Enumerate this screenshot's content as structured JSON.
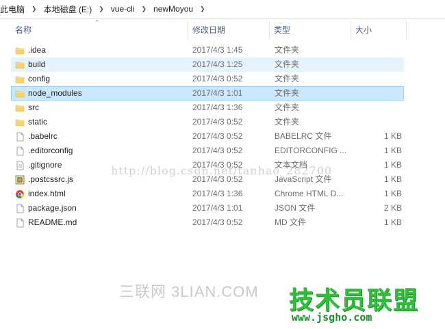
{
  "breadcrumb": [
    "此电脑",
    "本地磁盘 (E:)",
    "vue-cli",
    "newMoyou"
  ],
  "columns": {
    "name": "名称",
    "date": "修改日期",
    "type": "类型",
    "size": "大小"
  },
  "files": [
    {
      "name": ".idea",
      "date": "2017/4/3 1:45",
      "type": "文件夹",
      "size": "",
      "icon": "folder-icon",
      "state": "normal"
    },
    {
      "name": "build",
      "date": "2017/4/3 1:25",
      "type": "文件夹",
      "size": "",
      "icon": "folder-icon",
      "state": "hover"
    },
    {
      "name": "config",
      "date": "2017/4/3 0:52",
      "type": "文件夹",
      "size": "",
      "icon": "folder-icon",
      "state": "normal"
    },
    {
      "name": "node_modules",
      "date": "2017/4/3 1:01",
      "type": "文件夹",
      "size": "",
      "icon": "folder-icon",
      "state": "selected"
    },
    {
      "name": "src",
      "date": "2017/4/3 1:36",
      "type": "文件夹",
      "size": "",
      "icon": "folder-icon",
      "state": "normal"
    },
    {
      "name": "static",
      "date": "2017/4/3 0:52",
      "type": "文件夹",
      "size": "",
      "icon": "folder-icon",
      "state": "normal"
    },
    {
      "name": ".babelrc",
      "date": "2017/4/3 0:52",
      "type": "BABELRC 文件",
      "size": "1 KB",
      "icon": "file-icon",
      "state": "normal"
    },
    {
      "name": ".editorconfig",
      "date": "2017/4/3 0:52",
      "type": "EDITORCONFIG ...",
      "size": "1 KB",
      "icon": "file-icon",
      "state": "normal"
    },
    {
      "name": ".gitignore",
      "date": "2017/4/3 0:52",
      "type": "文本文档",
      "size": "1 KB",
      "icon": "text-file-icon",
      "state": "normal"
    },
    {
      "name": ".postcssrc.js",
      "date": "2017/4/3 0:52",
      "type": "JavaScript 文件",
      "size": "1 KB",
      "icon": "javascript-file-icon",
      "state": "normal"
    },
    {
      "name": "index.html",
      "date": "2017/4/3 1:36",
      "type": "Chrome HTML D...",
      "size": "1 KB",
      "icon": "chrome-icon",
      "state": "normal"
    },
    {
      "name": "package.json",
      "date": "2017/4/3 1:01",
      "type": "JSON 文件",
      "size": "2 KB",
      "icon": "file-icon",
      "state": "normal"
    },
    {
      "name": "README.md",
      "date": "2017/4/3 0:52",
      "type": "MD 文件",
      "size": "1 KB",
      "icon": "file-icon",
      "state": "normal"
    }
  ],
  "watermarks": {
    "url": "http://blog.csdn.net/tanhao_282700",
    "site": "三联网 3LIAN.COM",
    "logo": "技术员联盟",
    "domain": "www.jsgho.com"
  },
  "colors": {
    "folder": "#f7d46b",
    "folder_dark": "#e6b94a",
    "hover": "#e5f3ff",
    "selected": "#cce8ff",
    "selected_border": "#99d1ff",
    "header_text": "#4c607a"
  }
}
